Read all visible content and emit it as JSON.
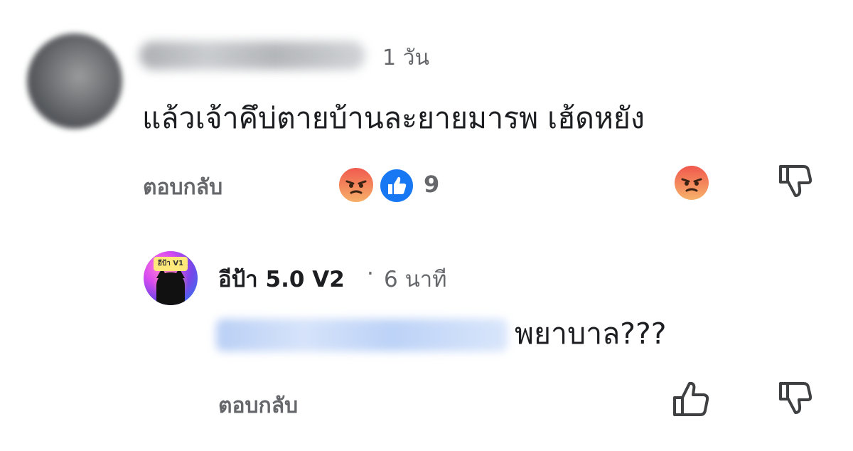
{
  "comment": {
    "time": "1 วัน",
    "text": "แล้วเจ้าคึบ่ตายบ้านละยายมารพ เฮ้ดหยัง",
    "reply_label": "ตอบกลับ",
    "reaction_count": "9",
    "reactions": [
      "angry-icon",
      "like-icon"
    ]
  },
  "reply": {
    "author": "อีป้า 5.0 V2",
    "separator": "·",
    "time": "6 นาที",
    "avatar_badge": "อีป้า V1",
    "text": "พยาบาล???",
    "reply_label": "ตอบกลับ"
  },
  "colors": {
    "secondary_text": "#65676b",
    "primary_text": "#1c1e21",
    "like_blue": "#1877f2",
    "angry_orange": "#f0584d"
  }
}
